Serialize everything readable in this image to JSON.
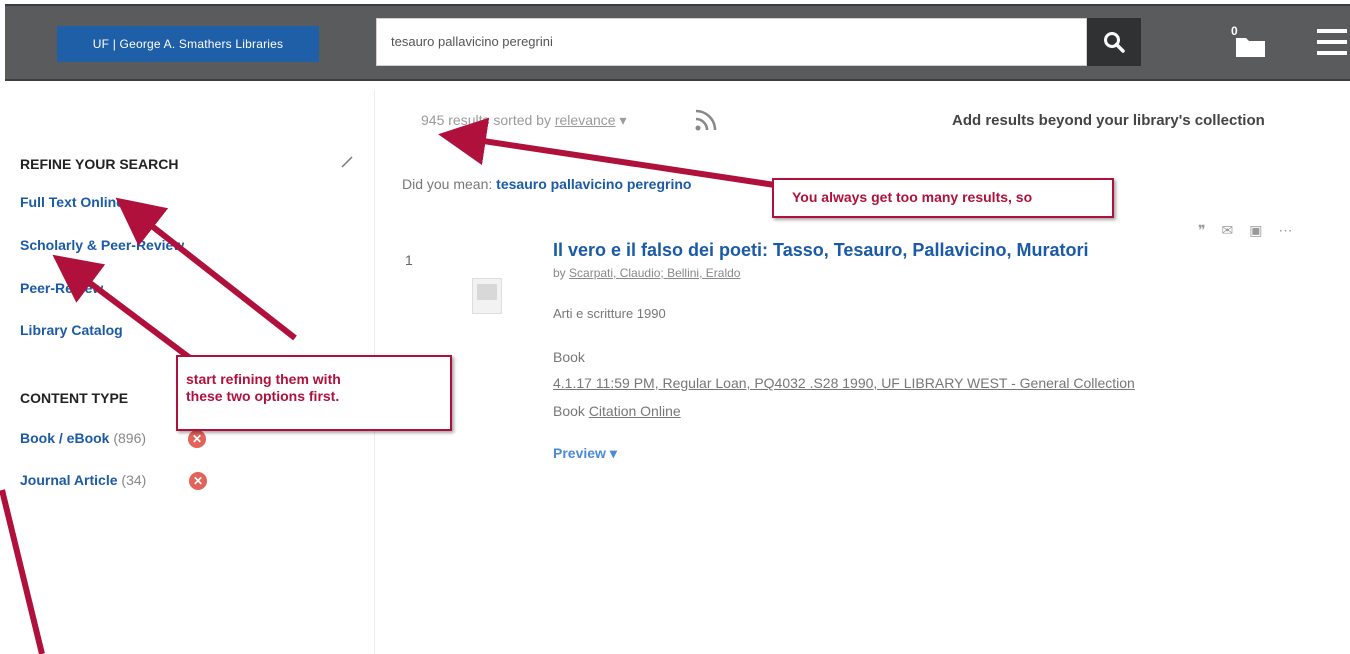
{
  "header": {
    "logo_text": "UF | George A. Smathers Libraries",
    "search_value": "tesauro pallavicino peregrini",
    "search_icon": "search-icon",
    "folder_count": "0",
    "folder_icon": "folder-icon",
    "menu_icon": "hamburger-menu-icon"
  },
  "sidebar": {
    "refine_heading": "REFINE YOUR SEARCH",
    "refine_links": [
      "Full Text Online",
      "Scholarly & Peer-Review",
      "Peer-Review",
      "Library Catalog"
    ],
    "content_type_heading": "CONTENT TYPE",
    "content_types": [
      {
        "label": "Book / eBook",
        "count": "(896)"
      },
      {
        "label": "Journal Article",
        "count": "(34)"
      }
    ]
  },
  "results": {
    "count_text": "945 results sorted by",
    "sort_label": "relevance",
    "add_beyond": "Add results beyond your library's collection",
    "did_you_mean_label": "Did you mean:",
    "did_you_mean_value": "tesauro pallavicino peregrino",
    "items": [
      {
        "number": "1",
        "title": "Il vero e il falso dei poeti: Tasso, Tesauro, Pallavicino, Muratori",
        "by": "by",
        "authors": "Scarpati, Claudio; Bellini, Eraldo",
        "publication": "Arti e scritture 1990",
        "format": "Book",
        "holding": "4.1.17 11:59 PM, Regular Loan, PQ4032 .S28 1990, UF LIBRARY WEST - General Collection",
        "format2": "Book",
        "citation": "Citation Online",
        "preview": "Preview"
      }
    ]
  },
  "annotations": {
    "callout_top": "You always get too many results, so",
    "callout_side_line1": "start refining them with",
    "callout_side_line2": "these two options first.",
    "arrow_color": "#b0113c"
  }
}
